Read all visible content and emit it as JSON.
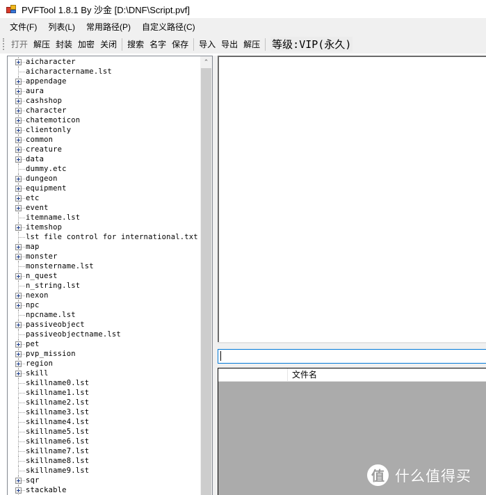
{
  "window": {
    "title": "PVFTool 1.8.1 By 沙金 [D:\\DNF\\Script.pvf]",
    "icon": "app-icon"
  },
  "menubar": {
    "items": [
      {
        "label": "文件(F)"
      },
      {
        "label": "列表(L)"
      },
      {
        "label": "常用路径(P)"
      },
      {
        "label": "自定义路径(C)"
      }
    ]
  },
  "toolbar": {
    "group1": [
      {
        "label": "打开",
        "enabled": false
      },
      {
        "label": "解压",
        "enabled": true
      },
      {
        "label": "封装",
        "enabled": true
      },
      {
        "label": "加密",
        "enabled": true
      },
      {
        "label": "关闭",
        "enabled": true
      }
    ],
    "group2": [
      {
        "label": "搜索"
      },
      {
        "label": "名字"
      },
      {
        "label": "保存"
      }
    ],
    "group3": [
      {
        "label": "导入"
      },
      {
        "label": "导出"
      },
      {
        "label": "解压"
      }
    ],
    "vip_label": "等级:VIP(永久)"
  },
  "tree": {
    "items": [
      {
        "label": "aicharacter",
        "expandable": true
      },
      {
        "label": "aicharactername.lst",
        "expandable": false
      },
      {
        "label": "appendage",
        "expandable": true
      },
      {
        "label": "aura",
        "expandable": true
      },
      {
        "label": "cashshop",
        "expandable": true
      },
      {
        "label": "character",
        "expandable": true
      },
      {
        "label": "chatemoticon",
        "expandable": true
      },
      {
        "label": "clientonly",
        "expandable": true
      },
      {
        "label": "common",
        "expandable": true
      },
      {
        "label": "creature",
        "expandable": true
      },
      {
        "label": "data",
        "expandable": true
      },
      {
        "label": "dummy.etc",
        "expandable": false
      },
      {
        "label": "dungeon",
        "expandable": true
      },
      {
        "label": "equipment",
        "expandable": true
      },
      {
        "label": "etc",
        "expandable": true
      },
      {
        "label": "event",
        "expandable": true
      },
      {
        "label": "itemname.lst",
        "expandable": false
      },
      {
        "label": "itemshop",
        "expandable": true
      },
      {
        "label": "lst file control for international.txt",
        "expandable": false
      },
      {
        "label": "map",
        "expandable": true
      },
      {
        "label": "monster",
        "expandable": true
      },
      {
        "label": "monstername.lst",
        "expandable": false
      },
      {
        "label": "n_quest",
        "expandable": true
      },
      {
        "label": "n_string.lst",
        "expandable": false
      },
      {
        "label": "nexon",
        "expandable": true
      },
      {
        "label": "npc",
        "expandable": true
      },
      {
        "label": "npcname.lst",
        "expandable": false
      },
      {
        "label": "passiveobject",
        "expandable": true
      },
      {
        "label": "passiveobjectname.lst",
        "expandable": false
      },
      {
        "label": "pet",
        "expandable": true
      },
      {
        "label": "pvp_mission",
        "expandable": true
      },
      {
        "label": "region",
        "expandable": true
      },
      {
        "label": "skill",
        "expandable": true
      },
      {
        "label": "skillname0.lst",
        "expandable": false
      },
      {
        "label": "skillname1.lst",
        "expandable": false
      },
      {
        "label": "skillname2.lst",
        "expandable": false
      },
      {
        "label": "skillname3.lst",
        "expandable": false
      },
      {
        "label": "skillname4.lst",
        "expandable": false
      },
      {
        "label": "skillname5.lst",
        "expandable": false
      },
      {
        "label": "skillname6.lst",
        "expandable": false
      },
      {
        "label": "skillname7.lst",
        "expandable": false
      },
      {
        "label": "skillname8.lst",
        "expandable": false
      },
      {
        "label": "skillname9.lst",
        "expandable": false
      },
      {
        "label": "sqr",
        "expandable": true
      },
      {
        "label": "stackable",
        "expandable": true
      }
    ],
    "scroll_up_glyph": "⌃"
  },
  "search": {
    "value": "",
    "placeholder": ""
  },
  "file_list": {
    "columns": [
      {
        "label": ""
      },
      {
        "label": "文件名"
      }
    ],
    "rows": []
  },
  "watermark": {
    "badge": "值",
    "text": "什么值得买"
  }
}
